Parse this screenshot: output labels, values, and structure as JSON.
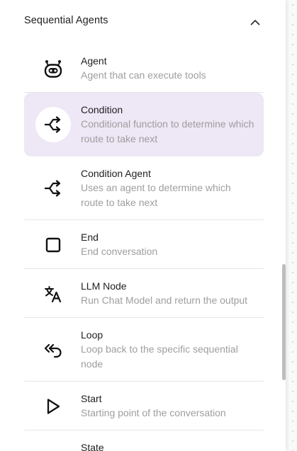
{
  "section": {
    "title": "Sequential Agents",
    "expanded": true,
    "collapse_icon": "chevron-up-icon"
  },
  "items": [
    {
      "key": "agent",
      "title": "Agent",
      "description": "Agent that can execute tools",
      "icon": "robot-icon",
      "selected": false
    },
    {
      "key": "condition",
      "title": "Condition",
      "description": "Conditional function to determine which route to take next",
      "icon": "split-arrow-icon",
      "selected": true
    },
    {
      "key": "condition-agent",
      "title": "Condition Agent",
      "description": "Uses an agent to determine which route to take next",
      "icon": "split-arrow-icon",
      "selected": false
    },
    {
      "key": "end",
      "title": "End",
      "description": "End conversation",
      "icon": "square-icon",
      "selected": false
    },
    {
      "key": "llm-node",
      "title": "LLM Node",
      "description": "Run Chat Model and return the output",
      "icon": "translate-icon",
      "selected": false
    },
    {
      "key": "loop",
      "title": "Loop",
      "description": "Loop back to the specific sequential node",
      "icon": "loop-back-icon",
      "selected": false
    },
    {
      "key": "start",
      "title": "Start",
      "description": "Starting point of the conversation",
      "icon": "play-icon",
      "selected": false
    },
    {
      "key": "state",
      "title": "State",
      "description": "",
      "icon": "state-icon",
      "selected": false
    }
  ],
  "colors": {
    "selected_bg": "#ede7f6",
    "title": "#1f1f1f",
    "description": "#9e9e9e",
    "divider": "#e6e6e6"
  }
}
